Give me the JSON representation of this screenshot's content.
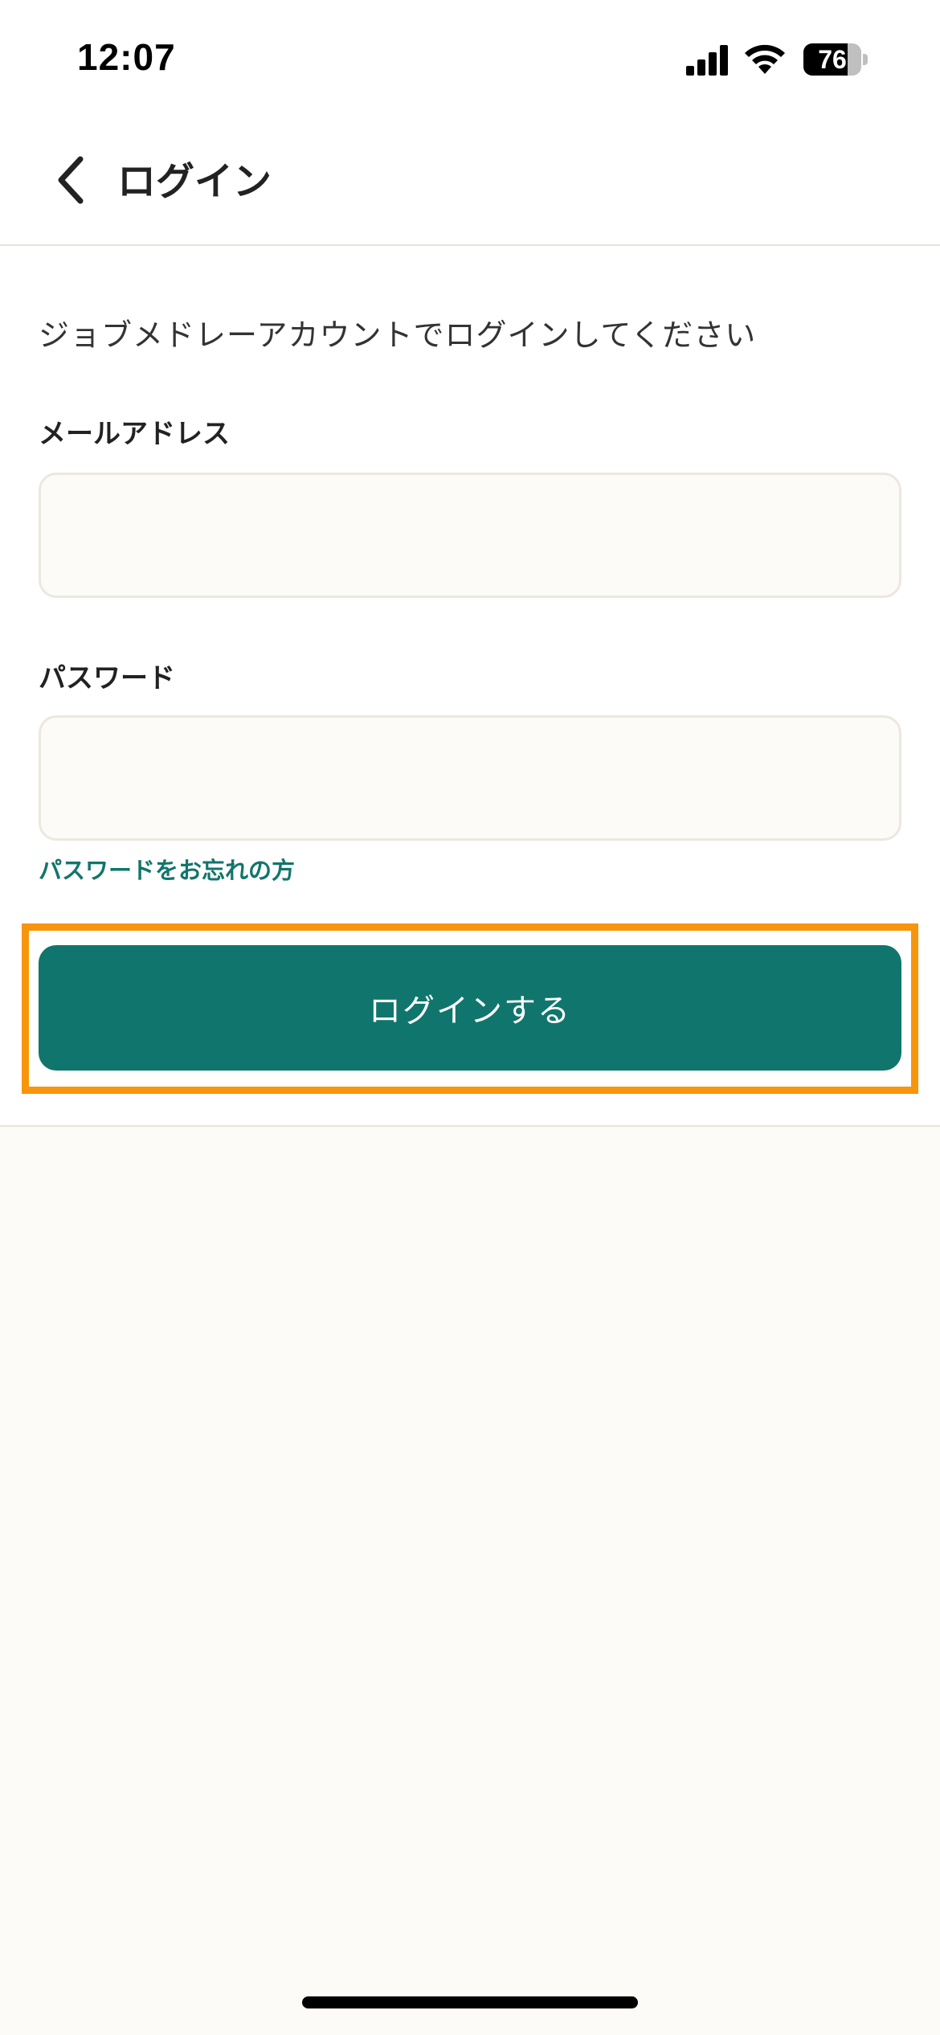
{
  "status_bar": {
    "time": "12:07",
    "battery_level": "76",
    "battery_fraction": 0.76,
    "icons": [
      "cellular-signal-icon",
      "wifi-icon",
      "battery-icon"
    ]
  },
  "header": {
    "back_icon": "chevron-left-icon",
    "title": "ログイン"
  },
  "form": {
    "intro": "ジョブメドレーアカウントでログインしてください",
    "email": {
      "label": "メールアドレス",
      "value": ""
    },
    "password": {
      "label": "パスワード",
      "value": ""
    },
    "forgot_password": "パスワードをお忘れの方",
    "submit_label": "ログインする"
  },
  "colors": {
    "accent": "#10766d",
    "link": "#12756c",
    "highlight": "#f7950d",
    "page_background": "#fcfbf7",
    "input_border": "#ebe8e0"
  }
}
